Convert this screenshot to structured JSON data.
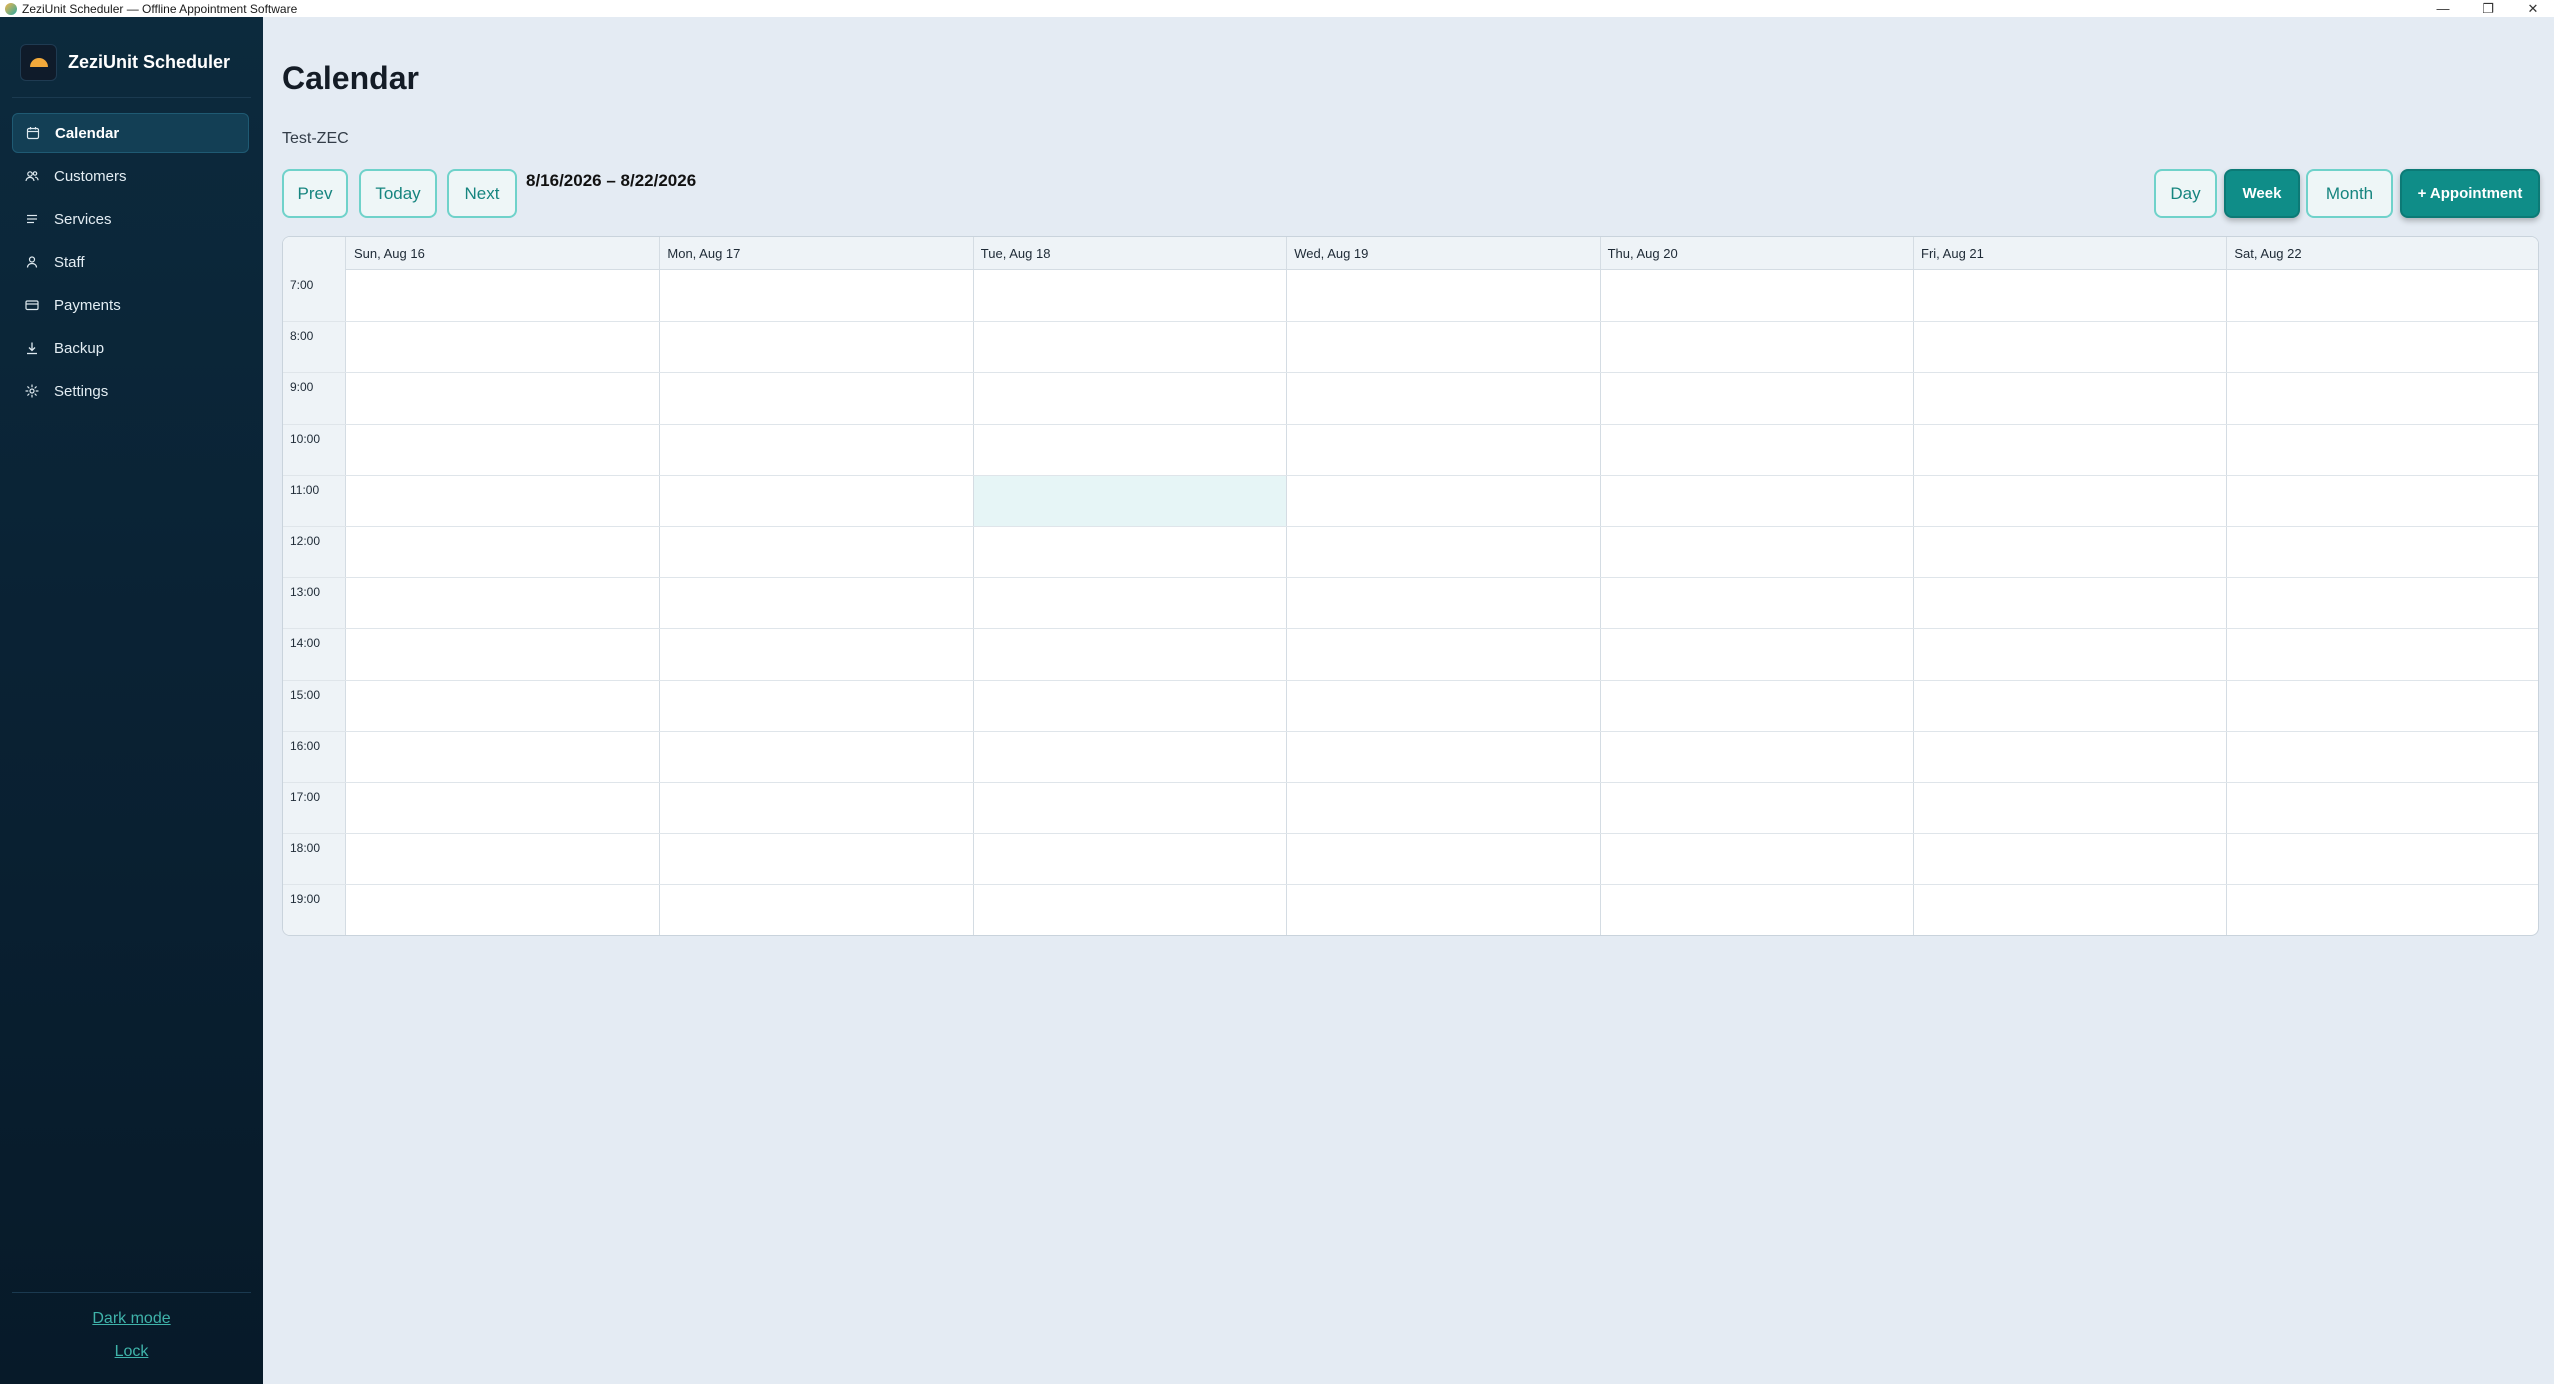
{
  "window": {
    "title": "ZeziUnit Scheduler — Offline Appointment Software",
    "minimize_glyph": "—",
    "restore_glyph": "❐",
    "close_glyph": "✕"
  },
  "sidebar": {
    "brand": "ZeziUnit Scheduler",
    "items": [
      {
        "label": "Calendar",
        "icon": "calendar-icon",
        "active": true
      },
      {
        "label": "Customers",
        "icon": "users-icon"
      },
      {
        "label": "Services",
        "icon": "list-icon"
      },
      {
        "label": "Staff",
        "icon": "person-icon"
      },
      {
        "label": "Payments",
        "icon": "card-icon"
      },
      {
        "label": "Backup",
        "icon": "download-icon"
      },
      {
        "label": "Settings",
        "icon": "gear-icon"
      }
    ],
    "dark_mode_label": "Dark mode",
    "lock_label": "Lock"
  },
  "main": {
    "title": "Calendar",
    "subtitle": "Test-ZEC",
    "nav_buttons": {
      "prev": "Prev",
      "today": "Today",
      "next": "Next"
    },
    "date_range": "8/16/2026 – 8/22/2026",
    "view_buttons": {
      "day": "Day",
      "week": "Week",
      "month": "Month"
    },
    "active_view": "Week",
    "add_button": "+ Appointment"
  },
  "calendar": {
    "days": [
      "Sun, Aug 16",
      "Mon, Aug 17",
      "Tue, Aug 18",
      "Wed, Aug 19",
      "Thu, Aug 20",
      "Fri, Aug 21",
      "Sat, Aug 22"
    ],
    "hours": [
      "7:00",
      "8:00",
      "9:00",
      "10:00",
      "11:00",
      "12:00",
      "13:00",
      "14:00",
      "15:00",
      "16:00",
      "17:00",
      "18:00",
      "19:00"
    ],
    "highlighted_slot": {
      "day": "Tue, Aug 18",
      "hour": "11:00"
    }
  },
  "colors": {
    "accent": "#0f8d88",
    "sidebar_bg": "#0a2234",
    "highlight": "#e6f5f6"
  }
}
